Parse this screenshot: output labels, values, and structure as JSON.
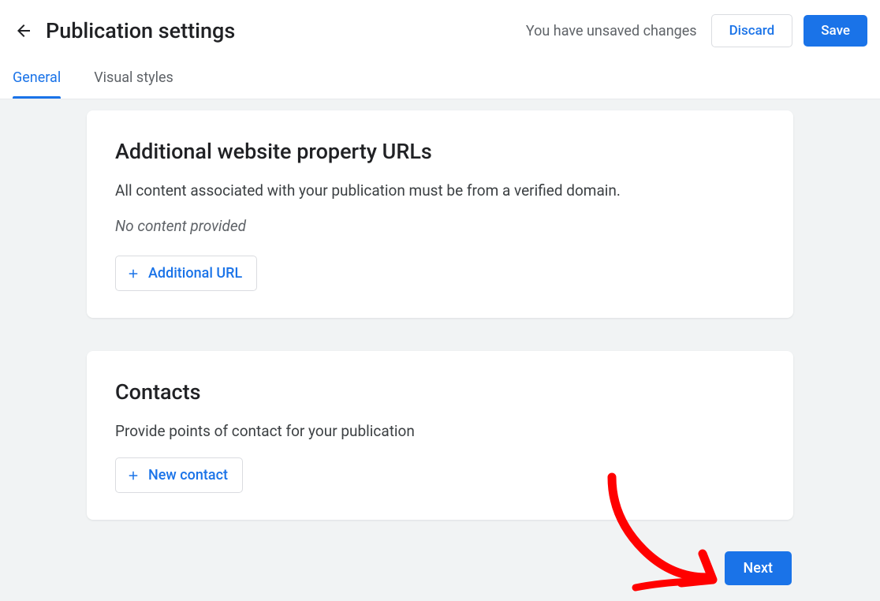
{
  "header": {
    "title": "Publication settings",
    "unsaved_message": "You have unsaved changes",
    "discard_label": "Discard",
    "save_label": "Save"
  },
  "tabs": {
    "general": "General",
    "visual_styles": "Visual styles"
  },
  "card1": {
    "title": "Additional website property URLs",
    "description": "All content associated with your publication must be from a verified domain.",
    "empty_state": "No content provided",
    "button_label": "Additional URL"
  },
  "card2": {
    "title": "Contacts",
    "description": "Provide points of contact for your publication",
    "button_label": "New contact"
  },
  "footer": {
    "next_label": "Next"
  }
}
